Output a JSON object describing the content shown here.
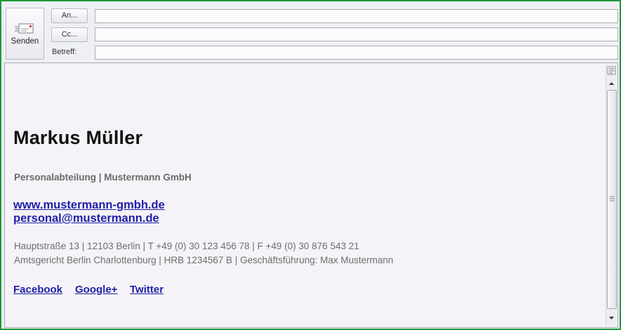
{
  "toolbar": {
    "send_label": "Senden",
    "to_label": "An...",
    "cc_label": "Cc...",
    "subject_label": "Betreff:"
  },
  "fields": {
    "to_value": "",
    "cc_value": "",
    "subject_value": ""
  },
  "signature": {
    "name": "Markus Müller",
    "department": "Personalabteilung | Mustermann GmbH",
    "website": "www.mustermann-gmbh.de",
    "email": "personal@mustermann.de",
    "address_line": "Hauptstraße 13 | 12103 Berlin | T +49 (0) 30 123 456 78 | F +49 (0) 30 876 543 21",
    "legal_line": "Amtsgericht Berlin Charlottenburg | HRB 1234567 B | Geschäftsführung: Max Mustermann",
    "social": [
      "Facebook",
      "Google+",
      "Twitter"
    ]
  },
  "colors": {
    "frame_border": "#1d9a3a",
    "link": "#1f1fa8"
  },
  "icons": {
    "send": "envelope-send-icon",
    "scroll_up": "arrow-up-icon",
    "scroll_down": "arrow-down-icon",
    "ruler_toggle": "ruler-icon"
  }
}
